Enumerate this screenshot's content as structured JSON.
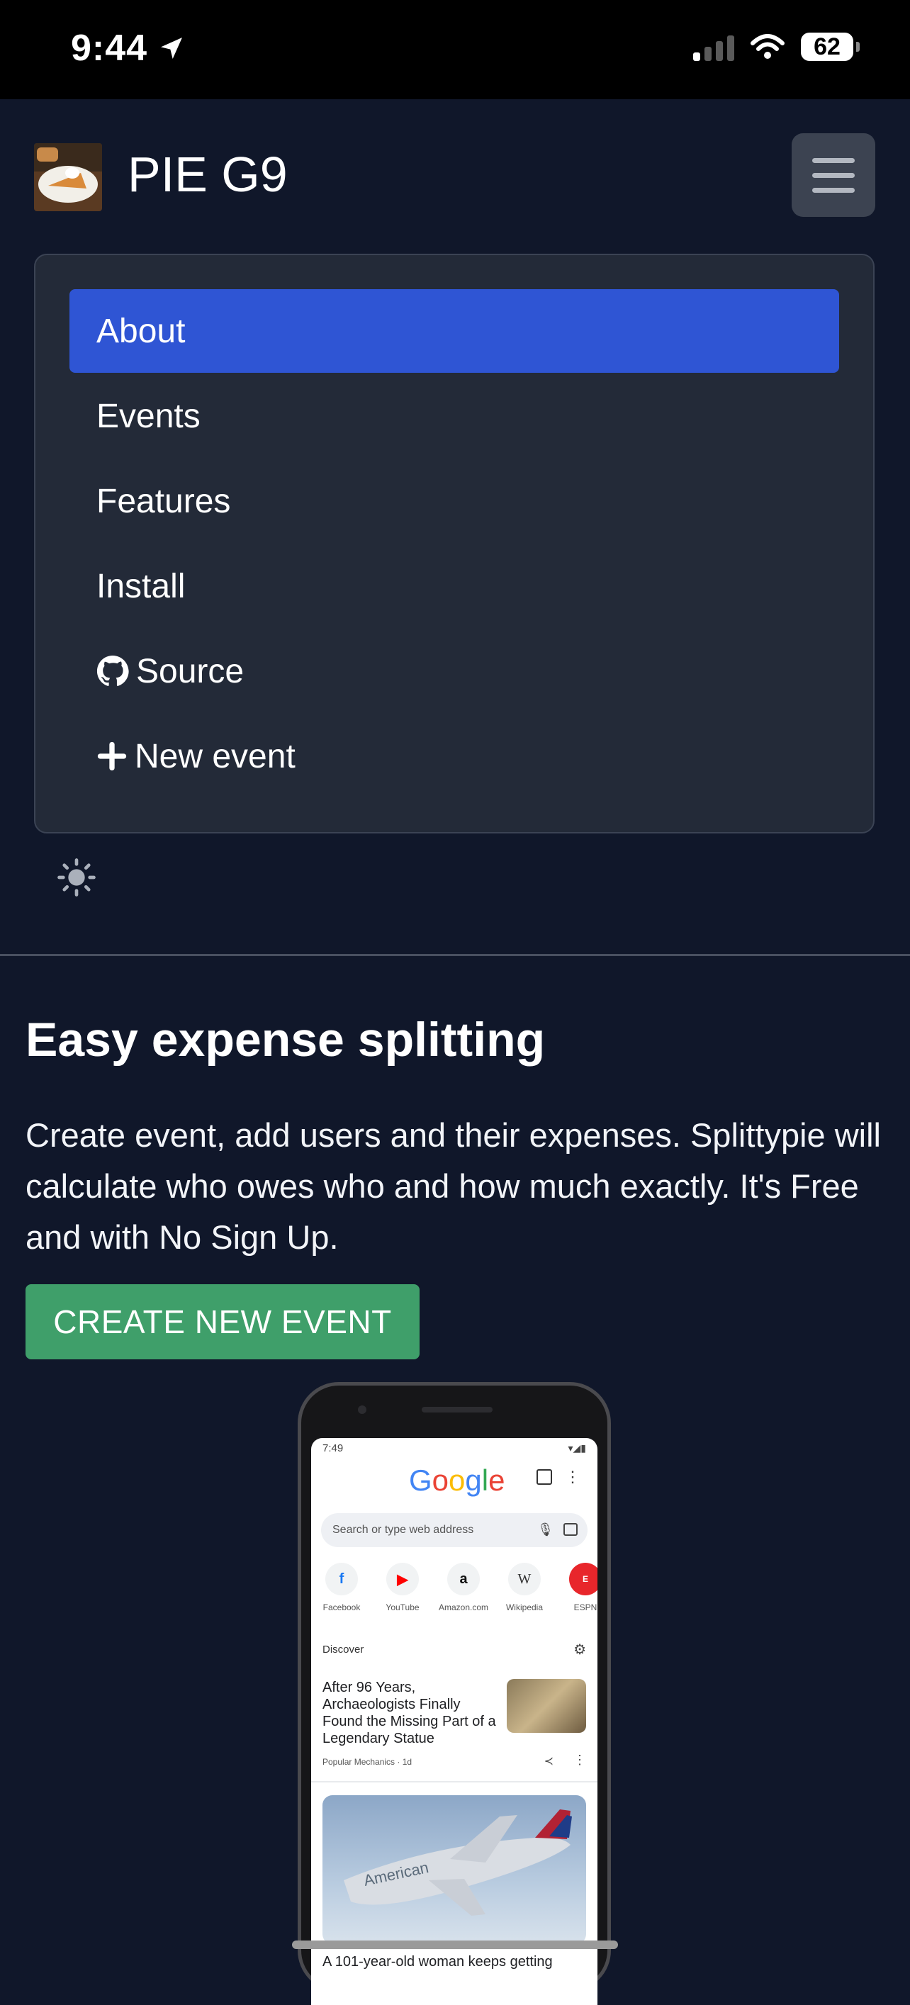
{
  "status_bar": {
    "time": "9:44",
    "battery": "62"
  },
  "navbar": {
    "brand": "PIE G9",
    "menu_items": [
      {
        "label": "About",
        "active": true
      },
      {
        "label": "Events",
        "active": false
      },
      {
        "label": "Features",
        "active": false
      },
      {
        "label": "Install",
        "active": false
      },
      {
        "label": "Source",
        "icon": "github-icon",
        "active": false
      },
      {
        "label": "New event",
        "icon": "plus-icon",
        "active": false
      }
    ],
    "theme_toggle_icon": "sun-icon"
  },
  "hero": {
    "title": "Easy expense splitting",
    "text": "Create event, add users and their expenses. Splittypie will calculate who owes who and how much exactly. It's Free and with No Sign Up.",
    "cta_label": "CREATE NEW EVENT"
  },
  "phone_mockup": {
    "status_time": "7:49",
    "logo": "Google",
    "search_placeholder": "Search or type web address",
    "shortcuts": [
      "Facebook",
      "YouTube",
      "Amazon.com",
      "Wikipedia",
      "ESPN"
    ],
    "discover_label": "Discover",
    "article1_title": "After 96 Years, Archaeologists Finally Found the Missing Part of a Legendary Statue",
    "article1_source": "Popular Mechanics · 1d",
    "article2_title": "A 101-year-old woman keeps getting",
    "plane_text": "American"
  },
  "colors": {
    "background": "#10172a",
    "nav_panel": "#232a38",
    "active_item": "#2f55d4",
    "cta": "#3f9f6a"
  }
}
